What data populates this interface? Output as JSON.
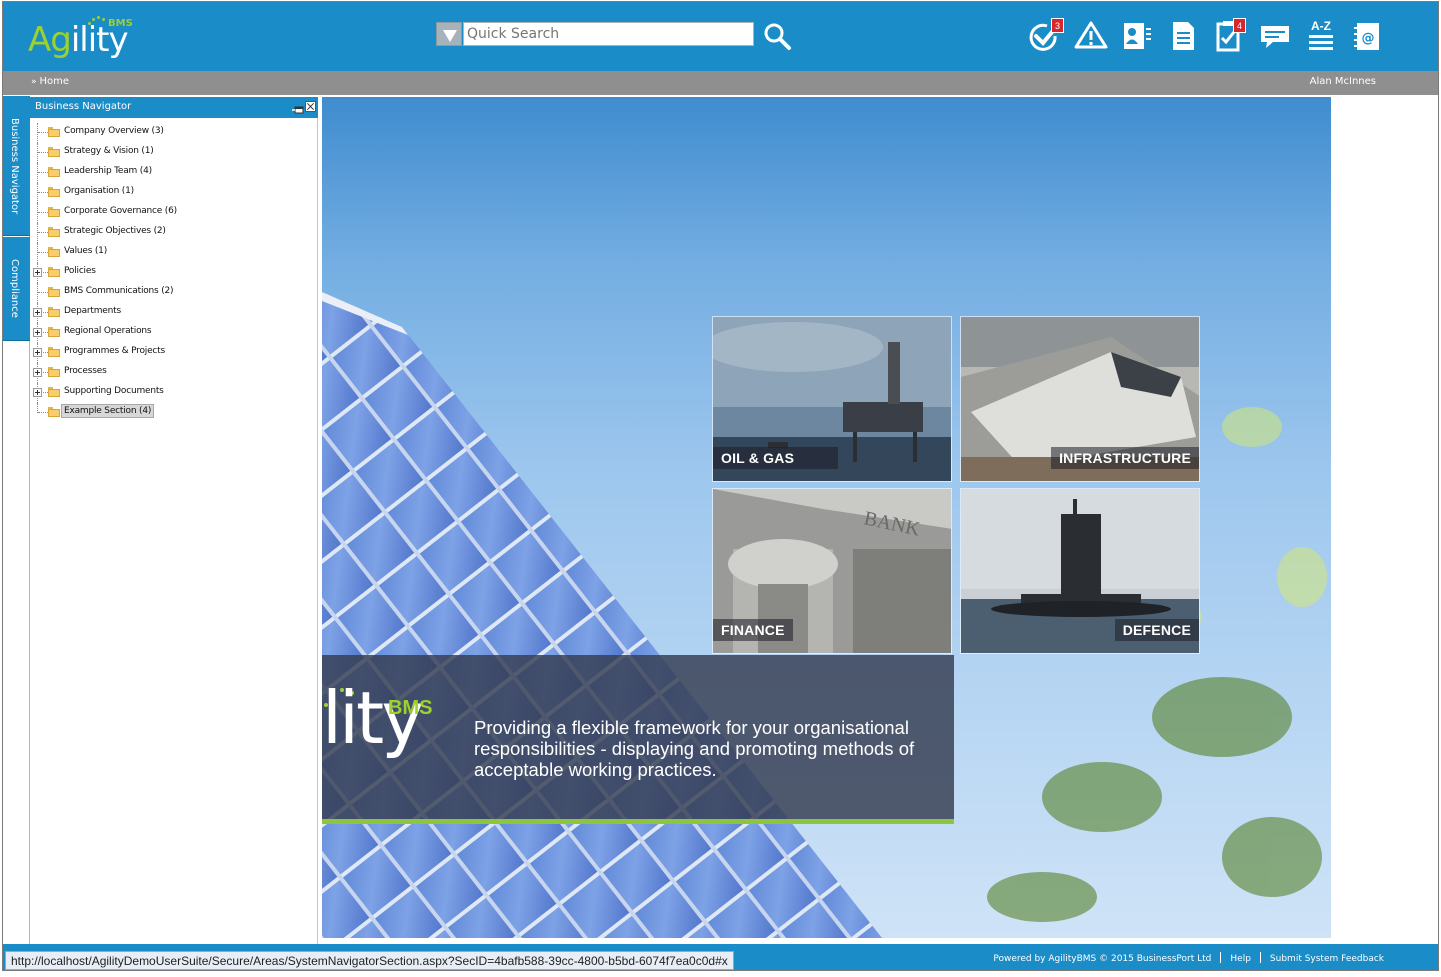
{
  "app": {
    "logo_text_a": "Ag",
    "logo_text_b": "ility",
    "logo_bms": "BMS"
  },
  "search": {
    "placeholder": "Quick Search",
    "value": ""
  },
  "toolbar": {
    "icons": [
      {
        "name": "tasks-check-icon",
        "badge": "3"
      },
      {
        "name": "warning-icon",
        "badge": ""
      },
      {
        "name": "contacts-card-icon",
        "badge": ""
      },
      {
        "name": "document-icon",
        "badge": ""
      },
      {
        "name": "clipboard-icon",
        "badge": "4"
      },
      {
        "name": "chat-icon",
        "badge": ""
      },
      {
        "name": "a-z-index-icon",
        "badge": "",
        "label": "A-Z"
      },
      {
        "name": "address-book-icon",
        "badge": ""
      }
    ]
  },
  "breadcrumb": {
    "sep": "»",
    "home": "Home"
  },
  "user": {
    "name": "Alan McInnes"
  },
  "sidetabs": {
    "business_navigator": "Business Navigator",
    "compliance": "Compliance"
  },
  "navigator": {
    "title": "Business Navigator",
    "items": [
      {
        "label": "Company Overview (3)",
        "expandable": false,
        "selected": false
      },
      {
        "label": "Strategy & Vision (1)",
        "expandable": false,
        "selected": false
      },
      {
        "label": "Leadership Team (4)",
        "expandable": false,
        "selected": false
      },
      {
        "label": "Organisation (1)",
        "expandable": false,
        "selected": false
      },
      {
        "label": "Corporate Governance (6)",
        "expandable": false,
        "selected": false
      },
      {
        "label": "Strategic Objectives (2)",
        "expandable": false,
        "selected": false
      },
      {
        "label": "Values (1)",
        "expandable": false,
        "selected": false
      },
      {
        "label": "Policies",
        "expandable": true,
        "selected": false
      },
      {
        "label": "BMS Communications (2)",
        "expandable": false,
        "selected": false
      },
      {
        "label": "Departments",
        "expandable": true,
        "selected": false
      },
      {
        "label": "Regional Operations",
        "expandable": true,
        "selected": false
      },
      {
        "label": "Programmes & Projects",
        "expandable": true,
        "selected": false
      },
      {
        "label": "Processes",
        "expandable": true,
        "selected": false
      },
      {
        "label": "Supporting Documents",
        "expandable": true,
        "selected": false
      },
      {
        "label": "Example Section (4)",
        "expandable": false,
        "selected": true
      }
    ]
  },
  "hero": {
    "tiles": {
      "oil_gas": "OIL & GAS",
      "infrastructure": "INFRASTRUCTURE",
      "finance": "FINANCE",
      "defence": "DEFENCE"
    },
    "banner_logo": "lity",
    "banner_bms": "BMS",
    "banner_text": "Providing a flexible framework for your organisational responsibilities -  displaying and promoting methods of acceptable working practices."
  },
  "status": {
    "url": "http://localhost/AgilityDemoUserSuite/Secure/Areas/SystemNavigatorSection.aspx?SecID=4bafb588-39cc-4800-b5bd-6074f7ea0c0d#x"
  },
  "footer": {
    "powered": "Powered by AgilityBMS © 2015 BusinessPort Ltd",
    "help": "Help",
    "feedback": "Submit System Feedback"
  },
  "colors": {
    "brand_blue": "#1a8cc8",
    "brand_green": "#9cd12e",
    "grey_bar": "#8f8f8f",
    "badge_red": "#d8262c"
  }
}
